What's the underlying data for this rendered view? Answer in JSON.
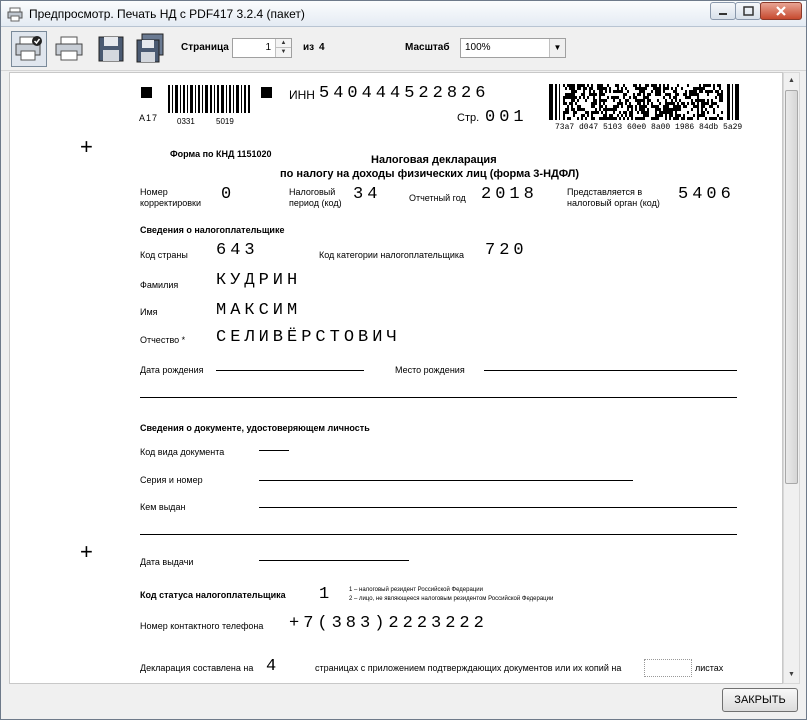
{
  "window": {
    "title": "Предпросмотр. Печать НД с PDF417 3.2.4 (пакет)"
  },
  "toolbar": {
    "page_label": "Страница",
    "page_value": "1",
    "of_label": "из",
    "total_pages": "4",
    "zoom_label": "Масштаб",
    "zoom_value": "100%"
  },
  "document": {
    "barcode_text": "A17",
    "barcode_num1": "0331",
    "barcode_num2": "5019",
    "inn_label": "ИНН",
    "inn_value": "540444522826",
    "page_label": "Стр.",
    "page_value": "001",
    "pdf417_code": "73a7 d047 5103 60e0 8a00 1986 84db 5a29",
    "form_knd": "Форма по КНД 1151020",
    "title_line1": "Налоговая декларация",
    "title_line2": "по налогу на доходы физических лиц (форма 3-НДФЛ)",
    "corr_label1": "Номер",
    "corr_label2": "корректировки",
    "corr_value": "0",
    "period_label1": "Налоговый",
    "period_label2": "период (код)",
    "period_value": "34",
    "year_label": "Отчетный год",
    "year_value": "2018",
    "organ_label1": "Представляется в",
    "organ_label2": "налоговый орган (код)",
    "organ_value": "5406",
    "section_taxpayer": "Сведения о налогоплательщике",
    "country_label": "Код страны",
    "country_value": "643",
    "category_label": "Код категории налогоплательщика",
    "category_value": "720",
    "surname_label": "Фамилия",
    "surname_value": "КУДРИН",
    "name_label": "Имя",
    "name_value": "МАКСИМ",
    "patronymic_label": "Отчество *",
    "patronymic_value": "СЕЛИВЁРСТОВИЧ",
    "birthdate_label": "Дата рождения",
    "birthplace_label": "Место рождения",
    "section_id_doc": "Сведения о документе, удостоверяющем личность",
    "doc_type_label": "Код вида документа",
    "series_label": "Серия и номер",
    "issued_by_label": "Кем выдан",
    "issue_date_label": "Дата выдачи",
    "status_label": "Код статуса налогоплательщика",
    "status_value": "1",
    "status_note1": "1 – налоговый резидент Российской Федерации",
    "status_note2": "2 – лицо, не являющееся налоговым резидентом Российской Федерации",
    "phone_label": "Номер контактного телефона",
    "phone_value": "+7(383)2223222",
    "pages_label": "Декларация составлена на",
    "pages_value": "4",
    "pages_mid": "страницах с приложением подтверждающих документов или их копий на",
    "sheets_label": "листах"
  },
  "footer": {
    "close_label": "ЗАКРЫТЬ"
  }
}
